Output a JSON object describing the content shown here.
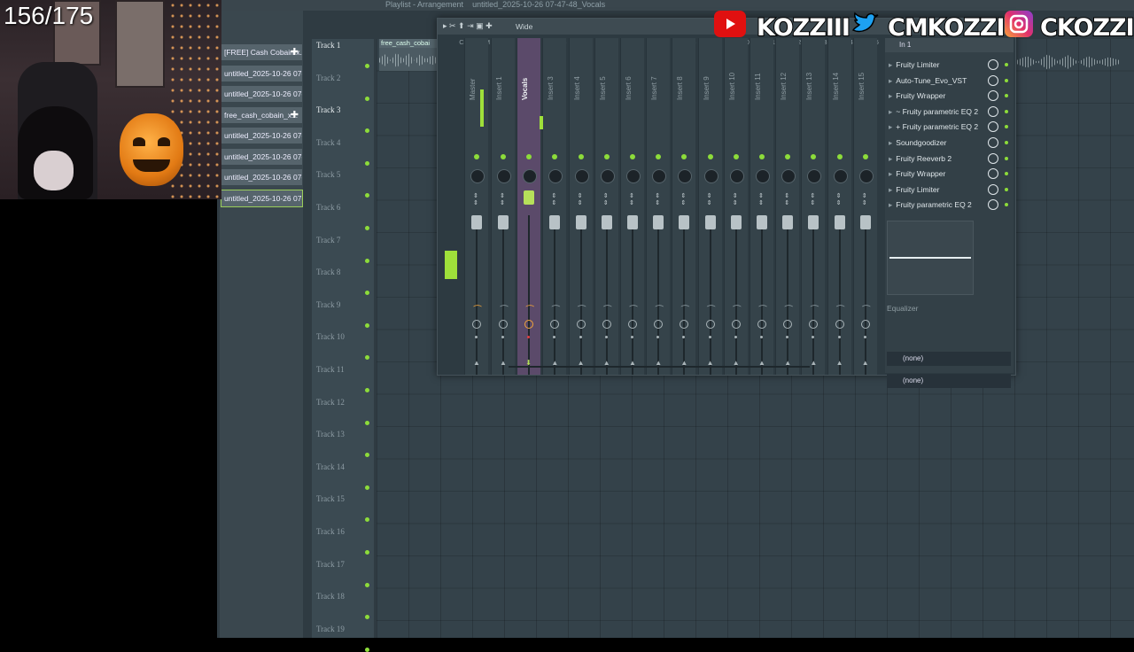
{
  "overlay": {
    "counter": "156/175",
    "social": [
      {
        "platform": "youtube",
        "icon": "youtube-icon",
        "handle": "KOZZIII",
        "color": "#ff0000"
      },
      {
        "platform": "twitter",
        "icon": "twitter-icon",
        "handle": "CMKOZZI",
        "color": "#1da1f2"
      },
      {
        "platform": "instagram",
        "icon": "instagram-icon",
        "handle": "CKOZZI",
        "color": "#c13584"
      }
    ]
  },
  "toolbar": {
    "playlist_label": "Playlist - Arrangement",
    "file_title": "untitled_2025-10-26 07-47-48_Vocals"
  },
  "browser": {
    "items": [
      {
        "label": "[FREE] Cash Cobain x...",
        "highlight": false
      },
      {
        "label": "untitled_2025-10-26 07-...",
        "highlight": false
      },
      {
        "label": "untitled_2025-10-26 07-...",
        "highlight": false
      },
      {
        "label": "free_cash_cobain_x...",
        "highlight": false
      },
      {
        "label": "untitled_2025-10-26 07-...",
        "highlight": false
      },
      {
        "label": "untitled_2025-10-26 07-...",
        "highlight": false
      },
      {
        "label": "untitled_2025-10-26 07-...",
        "highlight": false
      },
      {
        "label": "untitled_2025-10-26 07-...",
        "highlight": true
      }
    ]
  },
  "playlist": {
    "clip_label": "free_cash_cobai",
    "tracks": [
      "Track 1",
      "Track 2",
      "Track 3",
      "Track 4",
      "Track 5",
      "Track 6",
      "Track 7",
      "Track 8",
      "Track 9",
      "Track 10",
      "Track 11",
      "Track 12",
      "Track 13",
      "Track 14",
      "Track 15",
      "Track 16",
      "Track 17",
      "Track 18",
      "Track 19"
    ]
  },
  "mixer": {
    "preset": "Wide",
    "columns": [
      "C",
      "M",
      "1",
      "2",
      "3",
      "4",
      "5",
      "6",
      "7",
      "8",
      "9",
      "10",
      "11",
      "12",
      "13",
      "14",
      "15"
    ],
    "strips": [
      "Master",
      "Insert 1",
      "Vocals",
      "Insert 3",
      "Insert 4",
      "Insert 5",
      "Insert 6",
      "Insert 7",
      "Insert 8",
      "Insert 9",
      "Insert 10",
      "Insert 11",
      "Insert 12",
      "Insert 13",
      "Insert 14",
      "Insert 15"
    ],
    "selected": "Vocals",
    "input": "In 1",
    "slots": [
      "Fruity Limiter",
      "Auto-Tune_Evo_VST",
      "Fruity Wrapper",
      "~ Fruity parametric EQ 2",
      "+ Fruity parametric EQ 2",
      "Soundgoodizer",
      "Fruity Reeverb 2",
      "Fruity Wrapper",
      "Fruity Limiter",
      "Fruity parametric EQ 2"
    ],
    "eq_label": "Equalizer",
    "in_route": "(none)",
    "out_route": "(none)"
  }
}
